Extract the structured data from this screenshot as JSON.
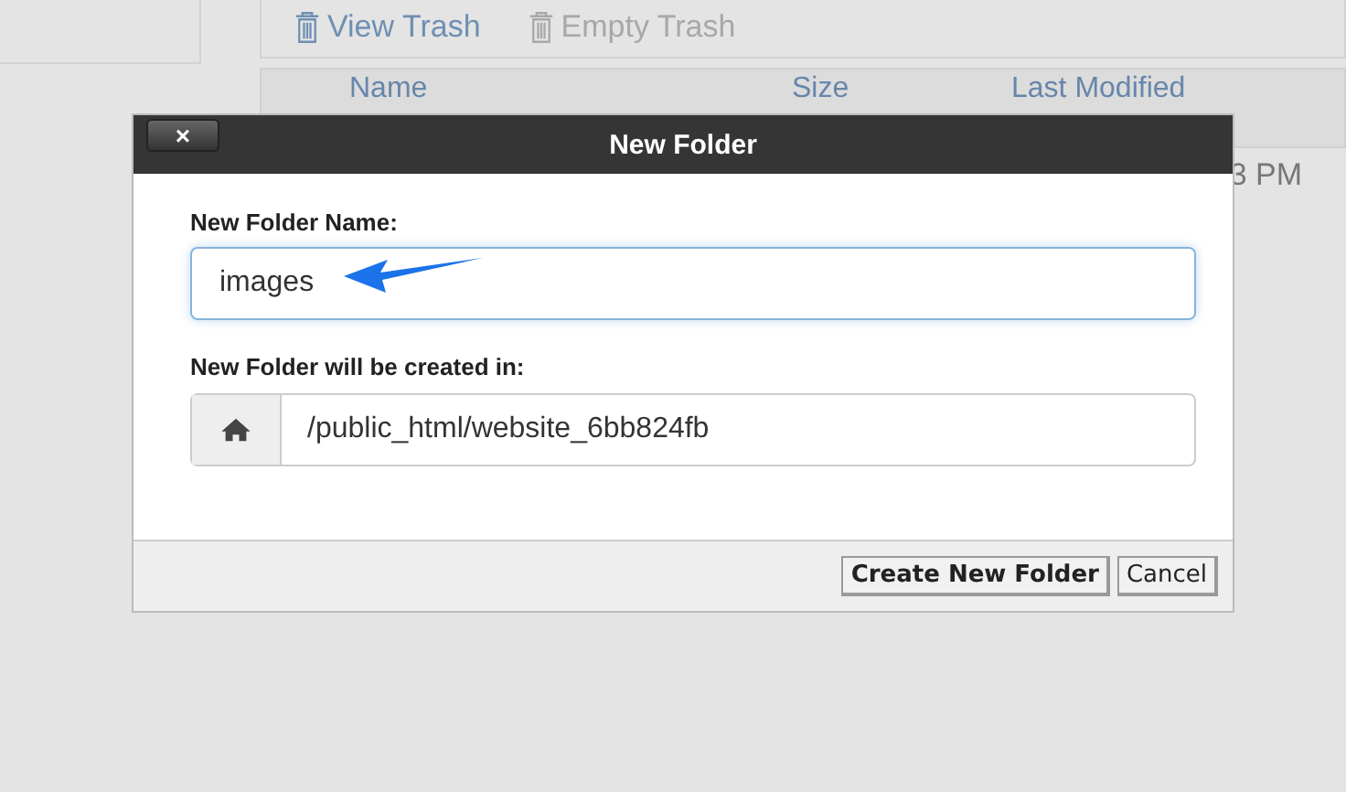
{
  "toolbar": [
    {
      "label": "View Trash",
      "disabled": false
    },
    {
      "label": "Empty Trash",
      "disabled": true
    }
  ],
  "table": {
    "columns": [
      "Name",
      "Size",
      "Last Modified"
    ],
    "rows": [
      {
        "column_3": "3 PM"
      }
    ]
  },
  "dialog": {
    "title": "New Folder",
    "close": "×",
    "name_label": "New Folder Name:",
    "name_value": "images",
    "location_label": "New Folder will be created in:",
    "location_value": "/public_html/website_6bb824fb",
    "buttons": [
      {
        "label": "Create New Folder",
        "kind": "primary"
      },
      {
        "label": "Cancel",
        "kind": "secondary"
      }
    ]
  }
}
